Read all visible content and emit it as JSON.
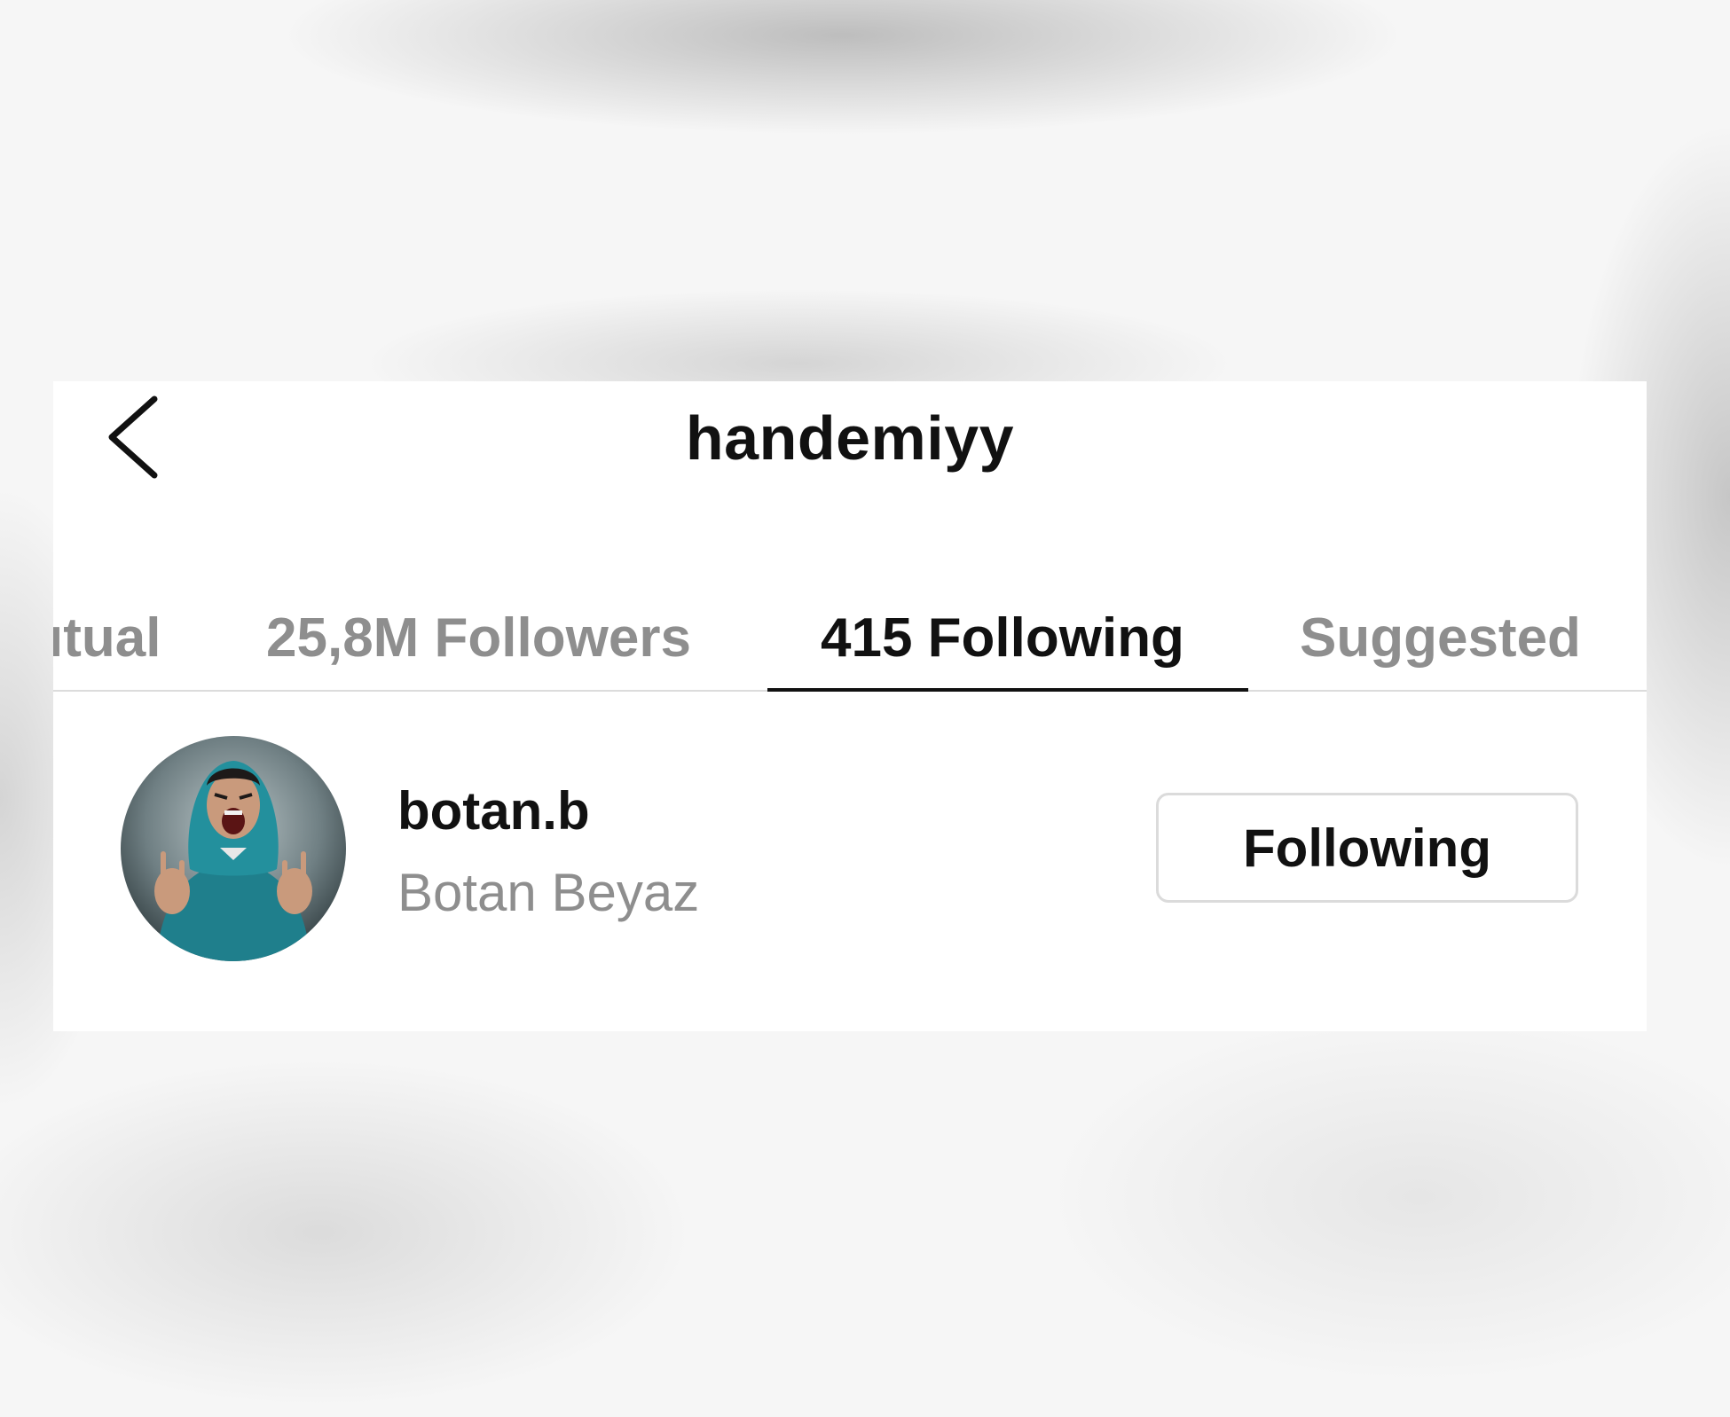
{
  "header": {
    "title": "handemiyy",
    "back_icon": "chevron-left-icon"
  },
  "tabs": [
    {
      "label": "Mutual",
      "visible_label": "ıtual",
      "active": false
    },
    {
      "label": "25,8M Followers",
      "active": false
    },
    {
      "label": "415 Following",
      "active": true
    },
    {
      "label": "Suggested",
      "active": false
    }
  ],
  "list": [
    {
      "username": "botan.b",
      "full_name": "Botan Beyaz",
      "button_label": "Following",
      "avatar": "profile-photo"
    }
  ],
  "colors": {
    "primary_text": "#111111",
    "secondary_text": "#8e8e8e",
    "divider": "#dcdcdc",
    "button_border": "#dbdbdb"
  }
}
